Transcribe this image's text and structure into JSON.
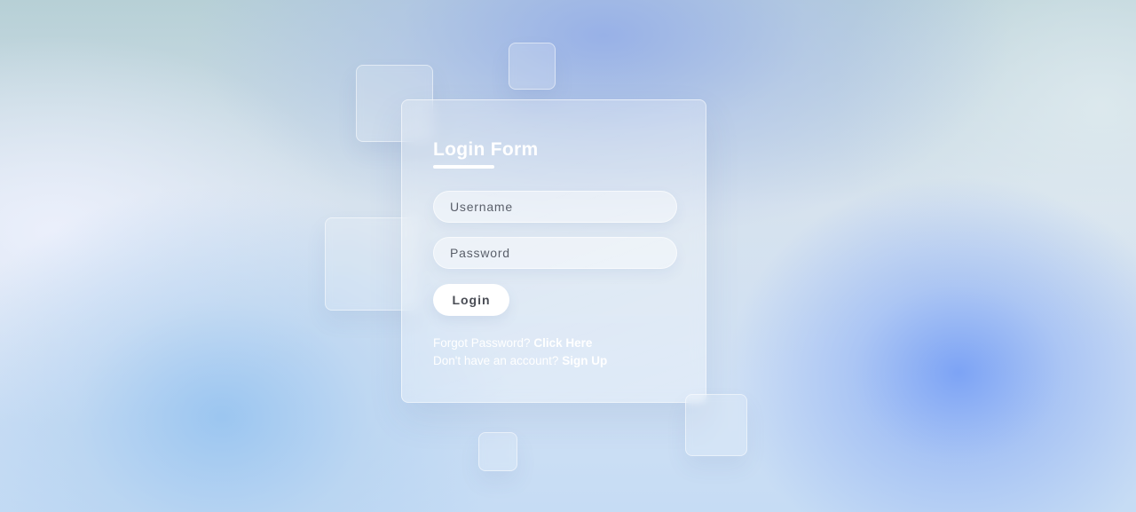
{
  "form": {
    "title": "Login Form",
    "username_placeholder": "Username",
    "password_placeholder": "Password",
    "login_label": "Login",
    "forgot_text": "Forgot Password?",
    "forgot_link": "Click Here",
    "signup_text": "Don't have an account?",
    "signup_link": "Sign Up"
  },
  "colors": {
    "text": "#ffffff",
    "button_bg": "#ffffff",
    "button_text": "#4a4d55",
    "accent_blob": "#8fb0f5"
  }
}
